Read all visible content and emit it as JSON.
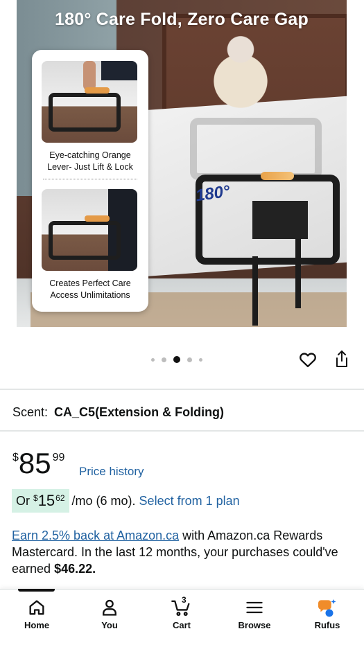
{
  "hero": {
    "headline": "180° Care Fold, Zero Care Gap",
    "degree_label": "180°",
    "inset": {
      "caption_1": "Eye-catching Orange Lever- Just Lift & Lock",
      "caption_2": "Creates Perfect Care Access Unlimitations"
    }
  },
  "carousel": {
    "dot_count": 5,
    "active_index": 2
  },
  "actions": {
    "favorite_icon": "heart-icon",
    "share_icon": "share-icon"
  },
  "variant": {
    "label": "Scent:",
    "value": "CA_C5(Extension & Folding)"
  },
  "price": {
    "currency": "$",
    "whole": "85",
    "fraction": "99",
    "history_link": "Price history"
  },
  "installment": {
    "prefix": "Or",
    "currency": "$",
    "whole": "15",
    "fraction": "62",
    "term": "/mo (6 mo).",
    "select_link": "Select from 1 plan",
    "badge_color": "#d5f1e5"
  },
  "rewards": {
    "link": "Earn 2.5% back at Amazon.ca",
    "text_1": " with Amazon.ca Rewards Mastercard. In the last 12 months, your purchases could've earned ",
    "amount": "$46.22."
  },
  "nav": {
    "items": [
      {
        "label": "Home",
        "icon": "home-icon"
      },
      {
        "label": "You",
        "icon": "person-icon"
      },
      {
        "label": "Cart",
        "icon": "cart-icon",
        "count": "3"
      },
      {
        "label": "Browse",
        "icon": "menu-icon"
      },
      {
        "label": "Rufus",
        "icon": "rufus-icon"
      }
    ]
  },
  "colors": {
    "link": "#2162a1",
    "text": "#0f1111",
    "rufus_orange": "#f08c2a",
    "rufus_blue": "#1a73e8"
  }
}
